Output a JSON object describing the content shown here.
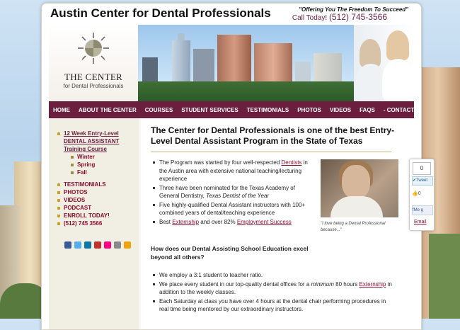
{
  "site": {
    "title": "Austin Center for Dental Professionals",
    "slogan": "\"Offering You The Freedom To Succeed\"",
    "call_label": "Call Today!",
    "phone": "(512) 745-3566"
  },
  "logo": {
    "line1": "THE CENTER",
    "line2": "for Dental Professionals"
  },
  "nav": {
    "items": [
      "HOME",
      "ABOUT THE CENTER",
      "COURSES",
      "STUDENT SERVICES",
      "TESTIMONIALS",
      "PHOTOS",
      "VIDEOS",
      "FAQS",
      "- CONTACT US -"
    ]
  },
  "sidebar": {
    "program_link": "12 Week Entry-Level DENTAL ASSISTANT Training Course",
    "sessions": [
      "Winter",
      "Spring",
      "Fall"
    ],
    "links": [
      "TESTIMONIALS",
      "PHOTOS",
      "VIDEOS",
      "PODCAST",
      "ENROLL TODAY!",
      "(512) 745 3566"
    ],
    "social_icons": [
      "facebook-icon",
      "twitter-icon",
      "linkedin-icon",
      "youtube-icon",
      "flickr-icon",
      "email-icon",
      "blog-icon"
    ]
  },
  "main": {
    "headline": "The Center for Dental Professionals is one of the best Entry-Level Dental Assistant Program in the State of Texas",
    "bullets1": [
      {
        "pre": "The Program was started by four well-respected ",
        "link": "Dentists",
        "post": " in the Austin area with extensive national teaching/lecturing experience"
      },
      {
        "pre": "Three have been nominated for the Texas Academy of General Dentistry, ",
        "em": "Texas Dentist of the Year",
        "post": ""
      },
      {
        "pre": "Five highly-qualified Dental Assistant instructors with 100+ combined years of dental/teaching experience",
        "post": ""
      },
      {
        "pre": "Best ",
        "link": "Externship",
        "mid": " and over 82% ",
        "link2": "Employment Success",
        "post": ""
      }
    ],
    "video_caption": "\"I love being a Dental Professional because...\"",
    "question": "How does our Dental Assisting School Education excel beyond all others?",
    "bullets2": [
      {
        "pre": "We employ a 3:1 student to teacher ratio.",
        "post": ""
      },
      {
        "pre": "We place every student in our top-quality dental offices for a ",
        "em": "minimum",
        "post": " 80 hours ",
        "link": "Externship",
        "post2": " in addition to the weekly classes."
      },
      {
        "pre": "Each Saturday at class you have over 4 hours at the dental chair performing procedures in real time being mentored by our extraordinary instructors.",
        "post": ""
      }
    ]
  },
  "share": {
    "count": "0",
    "tweet_label": "Tweet",
    "like_count": "0",
    "fb_label": "Me g",
    "email_label": "Email"
  },
  "colors": {
    "brand": "#6b1e3e",
    "link": "#8a0f2e",
    "accent": "#c9a227"
  }
}
